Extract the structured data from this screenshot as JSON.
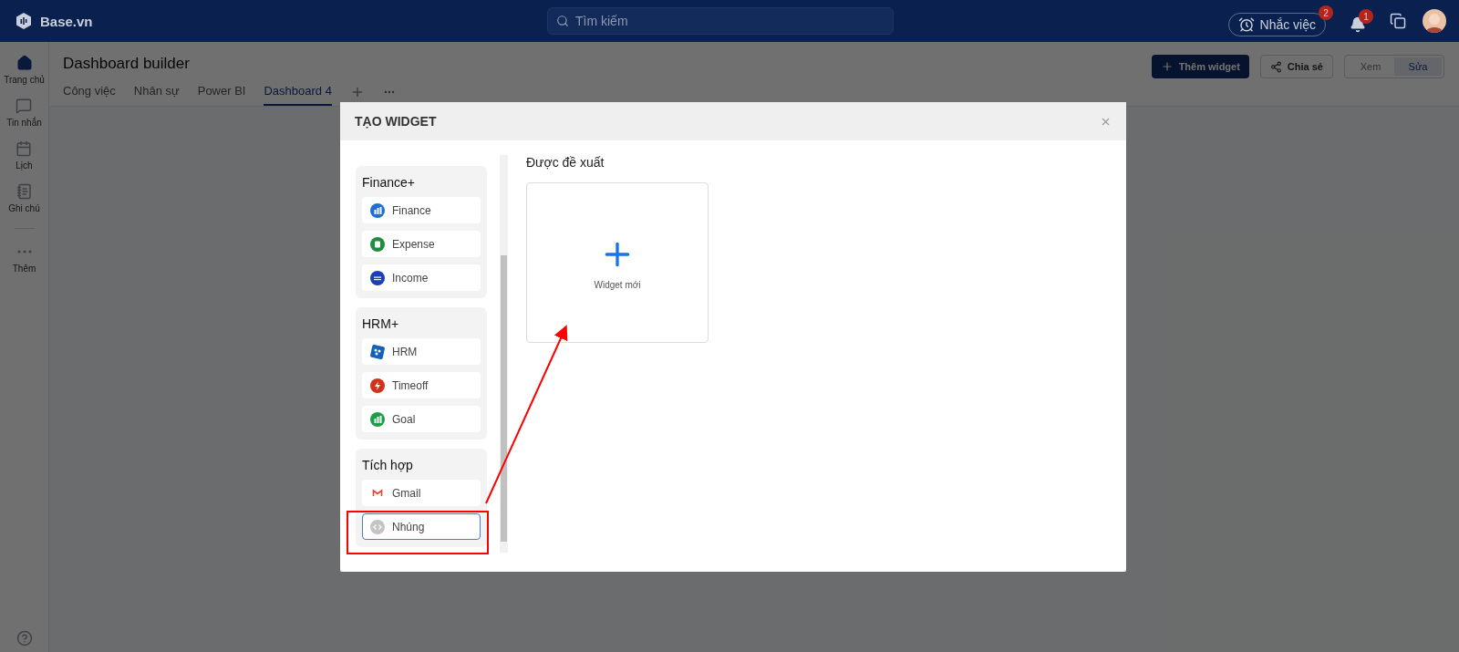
{
  "header": {
    "logo": "Base.vn",
    "search": {
      "placeholder": "Tìm kiếm"
    },
    "reminder": {
      "label": "Nhắc việc",
      "badge": "2"
    },
    "notifications": {
      "badge": "1"
    }
  },
  "sidebar": {
    "items": [
      {
        "label": "Trang chủ",
        "selected": true
      },
      {
        "label": "Tin nhắn",
        "selected": false
      },
      {
        "label": "Lịch",
        "selected": false
      },
      {
        "label": "Ghi chú",
        "selected": false
      },
      {
        "label": "Thêm",
        "selected": false
      }
    ]
  },
  "page": {
    "title": "Dashboard builder",
    "tabs": [
      {
        "label": "Công việc",
        "selected": false
      },
      {
        "label": "Nhân sự",
        "selected": false
      },
      {
        "label": "Power BI",
        "selected": false
      },
      {
        "label": "Dashboard 4",
        "selected": true
      }
    ],
    "add_button": "Thêm widget",
    "share_button": "Chia sẻ",
    "modes": [
      {
        "label": "Xem",
        "selected": false
      },
      {
        "label": "Sửa",
        "selected": true
      }
    ]
  },
  "dialog": {
    "title": "TẠO WIDGET",
    "groups": [
      {
        "title": "Finance+",
        "items": [
          {
            "label": "Finance",
            "kind": "bars",
            "color": "#1e6fd0",
            "selected": false
          },
          {
            "label": "Expense",
            "kind": "sheet",
            "color": "#1e8e3e",
            "selected": false
          },
          {
            "label": "Income",
            "kind": "person",
            "color": "#1a3fb8",
            "selected": false
          }
        ]
      },
      {
        "title": "HRM+",
        "items": [
          {
            "label": "HRM",
            "kind": "tile",
            "color": "#1560b8",
            "selected": false
          },
          {
            "label": "Timeoff",
            "kind": "bolt",
            "color": "#d0321e",
            "selected": false
          },
          {
            "label": "Goal",
            "kind": "bars",
            "color": "#1e9e48",
            "selected": false
          }
        ]
      },
      {
        "title": "Tích hợp",
        "items": [
          {
            "label": "Gmail",
            "kind": "mail",
            "color": "#ea4335",
            "selected": false
          },
          {
            "label": "Nhúng",
            "kind": "code",
            "color": "#c4c4c4",
            "selected": true
          }
        ]
      }
    ],
    "suggested": {
      "heading": "Được đề xuất",
      "card": "Widget mới"
    }
  }
}
